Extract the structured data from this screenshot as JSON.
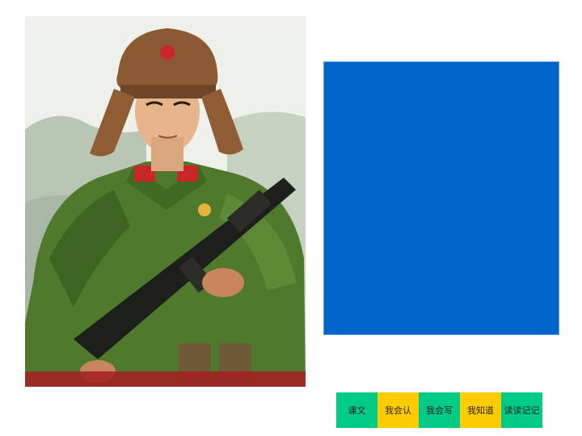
{
  "image": {
    "description_icon": "soldier-portrait-photo"
  },
  "nav": {
    "items": [
      {
        "label": "课文",
        "color": "#00cc88"
      },
      {
        "label": "我会认",
        "color": "#ffcc00"
      },
      {
        "label": "我会写",
        "color": "#00cc88"
      },
      {
        "label": "我知道",
        "color": "#ffcc00"
      },
      {
        "label": "读读记记",
        "color": "#00cc88"
      }
    ]
  },
  "colors": {
    "panel": "#0066cc",
    "background": "#ffffff"
  }
}
